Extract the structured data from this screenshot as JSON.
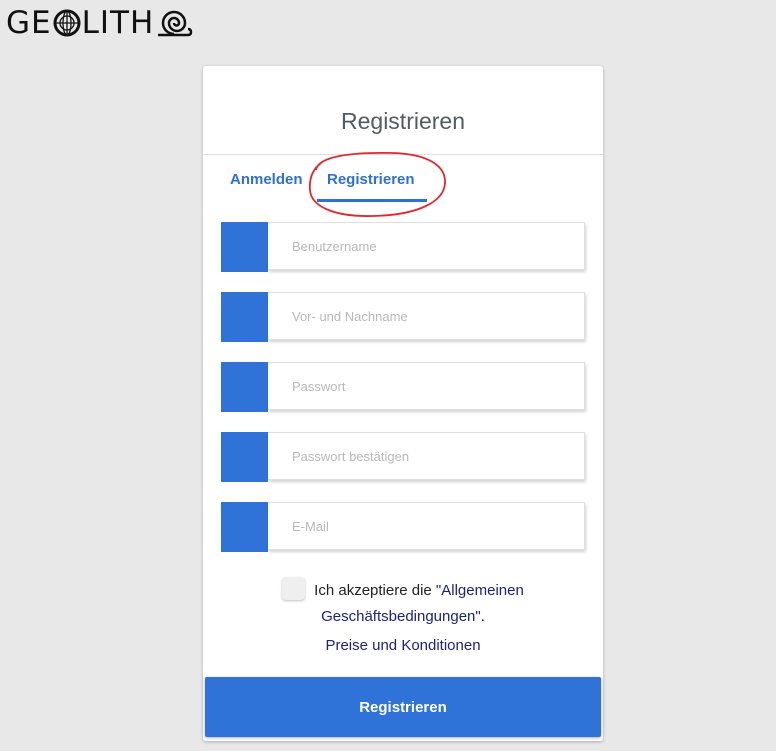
{
  "brand": {
    "logo_text_prefix": "GE",
    "logo_text_suffix": "LITH",
    "logo_icons": [
      "globe-icon",
      "snail-icon"
    ]
  },
  "card": {
    "title": "Registrieren",
    "tabs": [
      {
        "label": "Anmelden",
        "active": false
      },
      {
        "label": "Registrieren",
        "active": true
      }
    ]
  },
  "form": {
    "fields": [
      {
        "placeholder": "Benutzername",
        "value": ""
      },
      {
        "placeholder": "Vor- und Nachname",
        "value": ""
      },
      {
        "placeholder": "Passwort",
        "value": ""
      },
      {
        "placeholder": "Passwort bestätigen",
        "value": ""
      },
      {
        "placeholder": "E-Mail",
        "value": ""
      }
    ],
    "terms_prefix": "Ich akzeptiere die ",
    "terms_link_part1": "\"Allgemeinen",
    "terms_link_part2": "Geschäftsbedingungen\"",
    "terms_suffix": ".",
    "pricing_link": "Preise und Konditionen",
    "terms_checked": false,
    "submit_label": "Registrieren"
  },
  "colors": {
    "accent": "#2f73d8",
    "tab_text": "#2f6fd6",
    "link": "#1a237e",
    "annotation": "#e3262c",
    "background": "#e8e8e8"
  }
}
